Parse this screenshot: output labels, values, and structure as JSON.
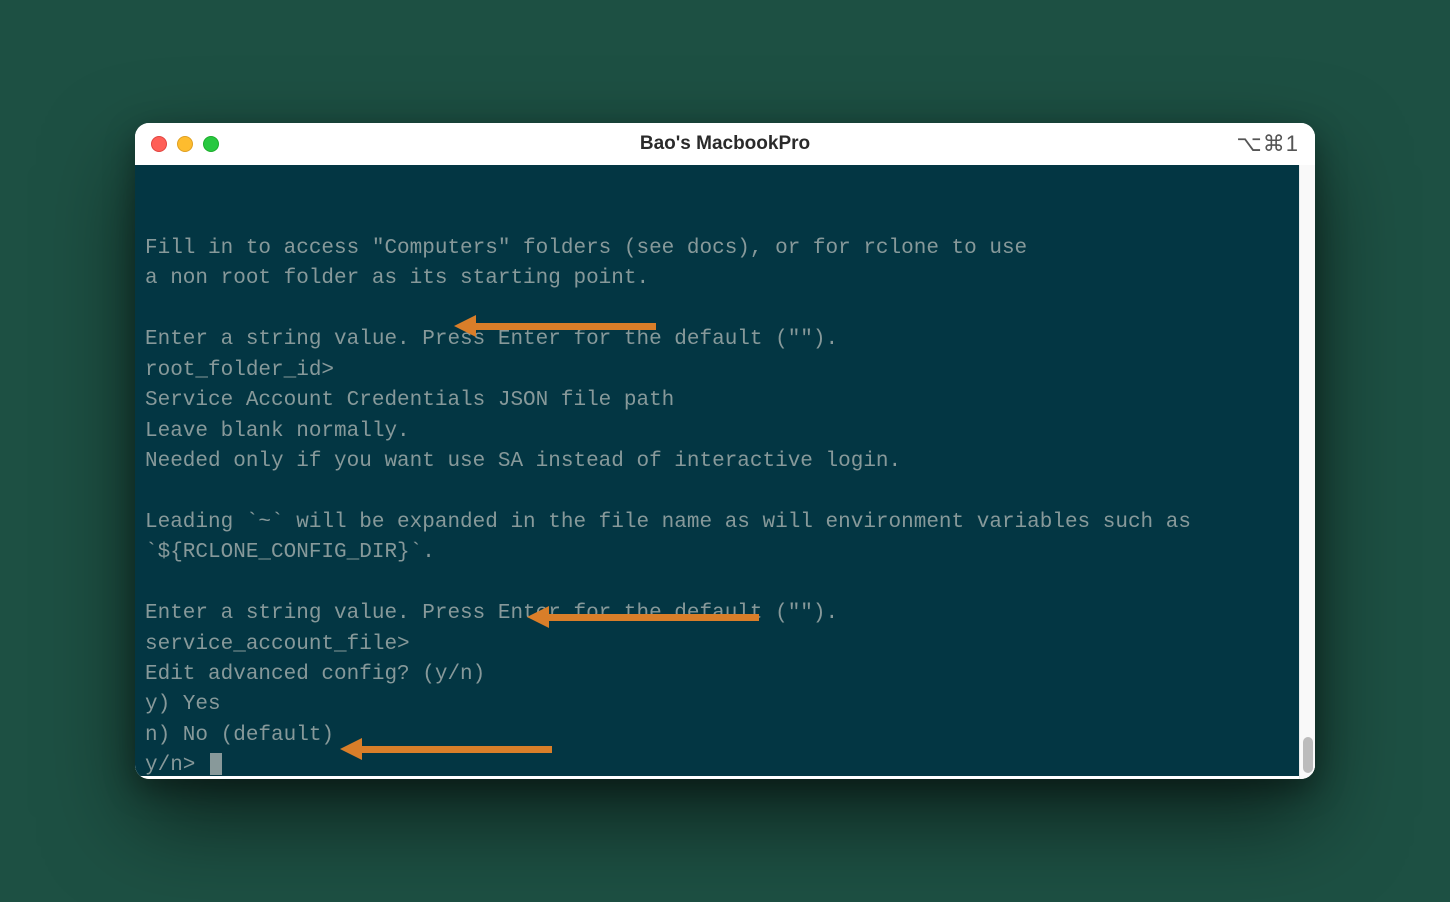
{
  "window": {
    "title": "Bao's MacbookPro",
    "shortcut": "⌥⌘1"
  },
  "terminal": {
    "lines": [
      "Fill in to access \"Computers\" folders (see docs), or for rclone to use",
      "a non root folder as its starting point.",
      "",
      "Enter a string value. Press Enter for the default (\"\").",
      "root_folder_id> ",
      "Service Account Credentials JSON file path",
      "Leave blank normally.",
      "Needed only if you want use SA instead of interactive login.",
      "",
      "Leading `~` will be expanded in the file name as will environment variables such as",
      "`${RCLONE_CONFIG_DIR}`.",
      "",
      "Enter a string value. Press Enter for the default (\"\").",
      "service_account_file> ",
      "Edit advanced config? (y/n)",
      "y) Yes",
      "n) No (default)",
      "y/n> "
    ]
  },
  "annotations": {
    "arrow_color": "#d97e29"
  }
}
